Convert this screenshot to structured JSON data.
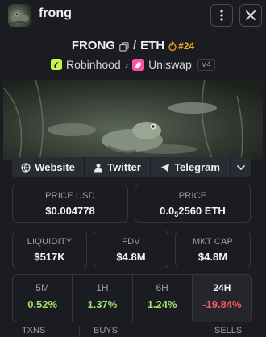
{
  "header": {
    "token_name": "frong",
    "avatar_icon": "frog-avatar",
    "menu_icon": "kebab-menu-icon",
    "close_icon": "close-icon"
  },
  "pair": {
    "base": "FRONG",
    "separator": "/",
    "quote": "ETH",
    "rank": "#24"
  },
  "chain": {
    "chain_name": "Robinhood",
    "dex_name": "Uniswap",
    "version": "V4"
  },
  "links": {
    "website": "Website",
    "twitter": "Twitter",
    "telegram": "Telegram"
  },
  "metrics": {
    "price_usd": {
      "label": "PRICE USD",
      "value": "$0.004778"
    },
    "price": {
      "label": "PRICE",
      "prefix": "0.0",
      "subscript": "5",
      "suffix": "2560 ETH"
    },
    "liquidity": {
      "label": "LIQUIDITY",
      "value": "$517K"
    },
    "fdv": {
      "label": "FDV",
      "value": "$4.8M"
    },
    "mkt_cap": {
      "label": "MKT CAP",
      "value": "$4.8M"
    }
  },
  "periods": [
    {
      "label": "5M",
      "value": "0.52%"
    },
    {
      "label": "1H",
      "value": "1.37%"
    },
    {
      "label": "6H",
      "value": "1.24%"
    },
    {
      "label": "24H",
      "value": "-19.84%"
    }
  ],
  "tx_labels": {
    "txns": "TXNS",
    "buys": "BUYS",
    "sells": "SELLS"
  },
  "colors": {
    "rank": "#f5a524",
    "positive": "#9ee26a",
    "negative": "#f35b6a",
    "robinhood": "#c6f24e",
    "uniswap": "#ff4fa8"
  }
}
